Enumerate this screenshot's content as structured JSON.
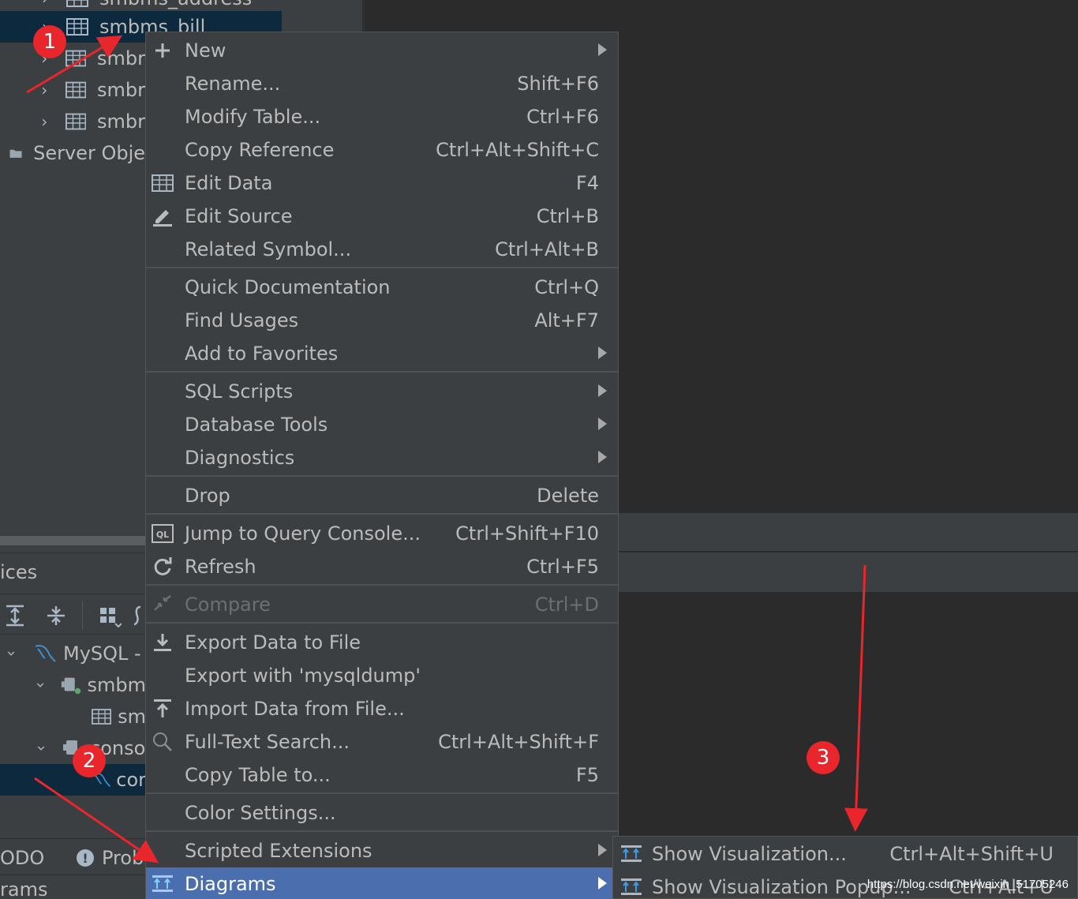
{
  "tree_top": {
    "items": [
      {
        "label": "smbms_address"
      },
      {
        "label": "smbms_bill"
      },
      {
        "label": "smbr"
      },
      {
        "label": "smbr"
      },
      {
        "label": "smbr"
      },
      {
        "label": "Server Obje"
      }
    ]
  },
  "lower_panel": {
    "header": "ices",
    "tree": [
      {
        "label": "MySQL -"
      },
      {
        "label": "smbm"
      },
      {
        "label": "sm"
      },
      {
        "label": "conso"
      },
      {
        "label": "cor"
      }
    ],
    "tabs": [
      {
        "label": "ODO"
      },
      {
        "label": "Probl"
      }
    ],
    "bottom_label": "rams"
  },
  "context_menu": {
    "items": [
      {
        "label": "New",
        "shortcut": "",
        "icon": "plus-icon",
        "submenu": true
      },
      {
        "label": "Rename...",
        "shortcut": "Shift+F6"
      },
      {
        "label": "Modify Table...",
        "shortcut": "Ctrl+F6"
      },
      {
        "label": "Copy Reference",
        "shortcut": "Ctrl+Alt+Shift+C"
      },
      {
        "label": "Edit Data",
        "shortcut": "F4",
        "icon": "table-icon"
      },
      {
        "label": "Edit Source",
        "shortcut": "Ctrl+B",
        "icon": "pencil-icon"
      },
      {
        "label": "Related Symbol...",
        "shortcut": "Ctrl+Alt+B"
      },
      {
        "label": "Quick Documentation",
        "shortcut": "Ctrl+Q"
      },
      {
        "label": "Find Usages",
        "shortcut": "Alt+F7"
      },
      {
        "label": "Add to Favorites",
        "shortcut": "",
        "submenu": true
      },
      {
        "label": "SQL Scripts",
        "shortcut": "",
        "submenu": true
      },
      {
        "label": "Database Tools",
        "shortcut": "",
        "submenu": true
      },
      {
        "label": "Diagnostics",
        "shortcut": "",
        "submenu": true
      },
      {
        "label": "Drop",
        "shortcut": "Delete"
      },
      {
        "label": "Jump to Query Console...",
        "shortcut": "Ctrl+Shift+F10",
        "icon": "ql-console-icon"
      },
      {
        "label": "Refresh",
        "shortcut": "Ctrl+F5",
        "icon": "refresh-icon"
      },
      {
        "label": "Compare",
        "shortcut": "Ctrl+D",
        "icon": "compare-icon",
        "disabled": true
      },
      {
        "label": "Export Data to File",
        "shortcut": "",
        "icon": "download-icon"
      },
      {
        "label": "Export with 'mysqldump'",
        "shortcut": ""
      },
      {
        "label": "Import Data from File...",
        "shortcut": "",
        "icon": "upload-icon"
      },
      {
        "label": "Full-Text Search...",
        "shortcut": "Ctrl+Alt+Shift+F",
        "icon": "search-icon"
      },
      {
        "label": "Copy Table to...",
        "shortcut": "F5"
      },
      {
        "label": "Color Settings...",
        "shortcut": ""
      },
      {
        "label": "Scripted Extensions",
        "shortcut": "",
        "submenu": true
      },
      {
        "label": "Diagrams",
        "shortcut": "",
        "icon": "diagram-icon",
        "submenu": true,
        "highlighted": true
      }
    ]
  },
  "submenu": {
    "items": [
      {
        "label": "Show Visualization...",
        "shortcut": "Ctrl+Alt+Shift+U"
      },
      {
        "label": "Show Visualization Popup...",
        "shortcut": "Ctrl+Alt+U"
      }
    ]
  },
  "annotations": {
    "badges": [
      "1",
      "2",
      "3"
    ],
    "color": "#e8262c"
  },
  "watermark": "https://blog.csdn.net/weixin_51705246",
  "colors": {
    "panel": "#3c3f41",
    "editor": "#2b2b2b",
    "highlight": "#4b6eaf",
    "selected_row": "#0d293e",
    "text": "#bbbbbb"
  }
}
